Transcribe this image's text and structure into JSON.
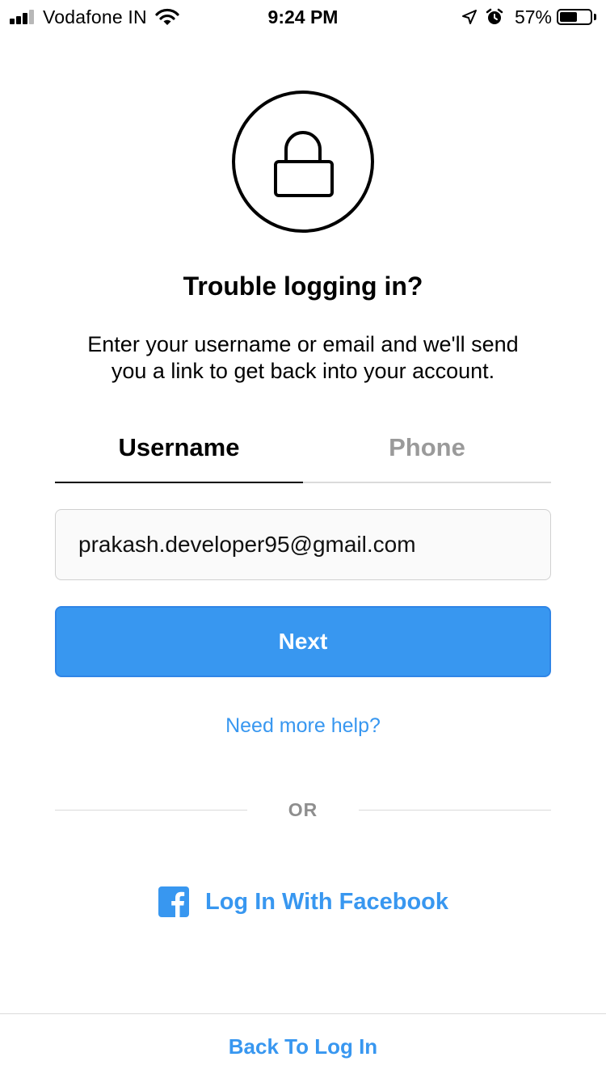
{
  "status_bar": {
    "carrier": "Vodafone IN",
    "time": "9:24 PM",
    "battery_percent_label": "57%",
    "battery_level": 0.57,
    "signal_bars_active": 3,
    "signal_bars_total": 4,
    "icons": [
      "signal-icon",
      "wifi-icon",
      "location-icon",
      "alarm-icon",
      "battery-icon"
    ]
  },
  "header": {
    "icon": "lock-icon",
    "title": "Trouble logging in?",
    "description": "Enter your username or email and we'll send you a link to get back into your account."
  },
  "tabs": [
    {
      "label": "Username",
      "active": true
    },
    {
      "label": "Phone",
      "active": false
    }
  ],
  "form": {
    "input_value": "prakash.developer95@gmail.com",
    "next_label": "Next"
  },
  "links": {
    "help": "Need more help?",
    "divider": "OR",
    "facebook": "Log In With Facebook",
    "back": "Back To Log In"
  },
  "colors": {
    "accent": "#3897f0",
    "inactive_tab": "#9a9a9a",
    "divider": "#dbdbdb",
    "input_background": "#fafafa"
  }
}
